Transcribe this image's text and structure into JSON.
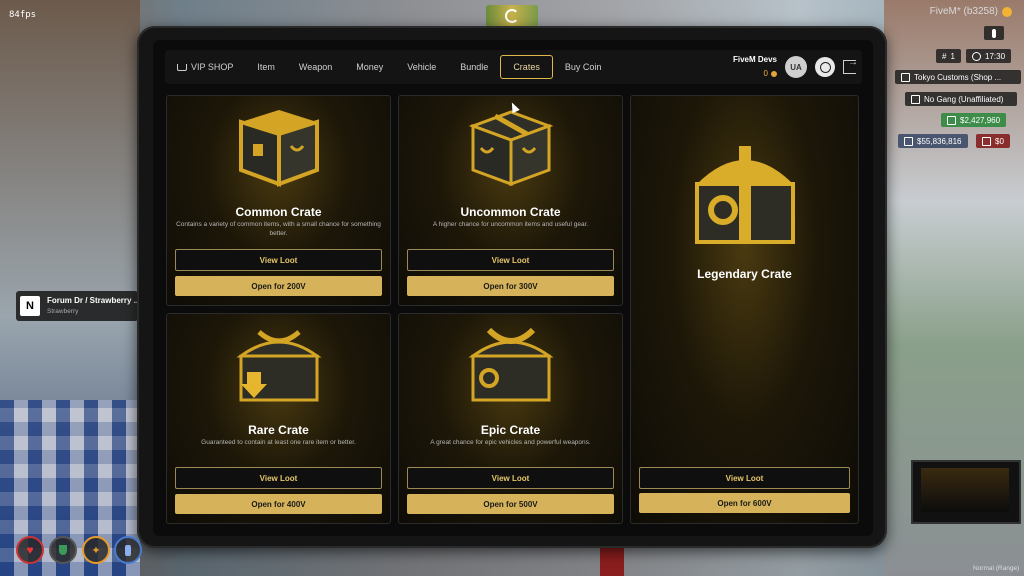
{
  "overlay": {
    "fps": "84fps",
    "fivem_id": "FiveM* (b3258)"
  },
  "nav": {
    "items": [
      {
        "label": "VIP SHOP",
        "icon": "cart-icon"
      },
      {
        "label": "Item"
      },
      {
        "label": "Weapon"
      },
      {
        "label": "Money"
      },
      {
        "label": "Vehicle"
      },
      {
        "label": "Bundle"
      },
      {
        "label": "Crates",
        "active": true
      },
      {
        "label": "Buy Coin"
      }
    ],
    "user_name": "FiveM Devs",
    "coins": "0",
    "avatar_initials": "UA"
  },
  "crates": [
    {
      "title": "Common Crate",
      "desc": "Contains a variety of common items, with a small chance for something better.",
      "view": "View Loot",
      "open": "Open for 200V"
    },
    {
      "title": "Uncommon Crate",
      "desc": "A higher chance for uncommon items and useful gear.",
      "view": "View Loot",
      "open": "Open for 300V"
    },
    {
      "title": "Legendary Crate",
      "desc": "",
      "view": "View Loot",
      "open": "Open for 600V"
    },
    {
      "title": "Rare Crate",
      "desc": "Guaranteed to contain at least one rare item or better.",
      "view": "View Loot",
      "open": "Open for 400V"
    },
    {
      "title": "Epic Crate",
      "desc": "A great chance for epic vehicles and powerful weapons.",
      "view": "View Loot",
      "open": "Open for 500V"
    }
  ],
  "hud": {
    "id": "1",
    "time": "17:30",
    "job": "Tokyo Customs (Shop ...",
    "gang": "No Gang (Unaffiliated)",
    "cash": "$2,427,960",
    "bank": "$55,836,816",
    "dirty": "$0"
  },
  "notification": {
    "icon_letter": "N",
    "title": "Forum Dr / Strawberry ...",
    "subtitle": "Strawberry"
  },
  "footer": {
    "mode": "Normal (Range)"
  },
  "colors": {
    "accent_gold": "#d6b35a",
    "cash_green": "#3d8c4a"
  }
}
